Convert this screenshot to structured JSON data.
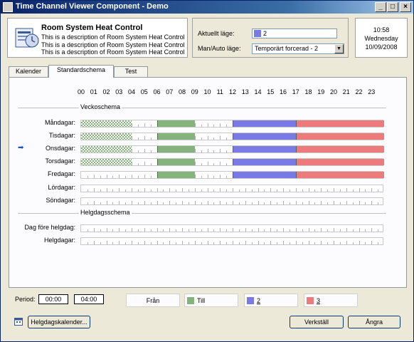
{
  "window": {
    "title": "Time Channel Viewer Component - Demo",
    "minimize": "_",
    "maximize": "□",
    "close": "×"
  },
  "header": {
    "title": "Room System Heat Control",
    "descriptions": [
      "This is a description of Room System Heat Control",
      "This is a description of Room System Heat Control",
      "This is a description of Room System Heat Control"
    ]
  },
  "mode": {
    "current_label": "Aktuellt läge:",
    "current_value": "2",
    "current_color": "#7a7ae6",
    "manual_label": "Man/Auto läge:",
    "manual_value": "Temporärt forcerad - 2"
  },
  "clock": {
    "time": "10:58",
    "day": "Wednesday",
    "date": "10/09/2008"
  },
  "tabs": [
    "Kalender",
    "Standardschema",
    "Test"
  ],
  "active_tab": "Standardschema",
  "hours": [
    "00",
    "01",
    "02",
    "03",
    "04",
    "05",
    "06",
    "07",
    "08",
    "09",
    "10",
    "11",
    "12",
    "13",
    "14",
    "15",
    "16",
    "17",
    "18",
    "19",
    "20",
    "21",
    "22",
    "23"
  ],
  "weekly": {
    "section_label": "Veckoschema",
    "days": [
      {
        "label": "Måndagar:",
        "segments": [
          [
            0,
            4,
            "check"
          ],
          [
            6,
            9,
            "t1"
          ],
          [
            12,
            17,
            "t2"
          ],
          [
            17,
            24,
            "t3"
          ]
        ]
      },
      {
        "label": "Tisdagar:",
        "segments": [
          [
            0,
            4,
            "check"
          ],
          [
            6,
            9,
            "t1"
          ],
          [
            12,
            17,
            "t2"
          ],
          [
            17,
            24,
            "t3"
          ]
        ]
      },
      {
        "label": "Onsdagar:",
        "current": true,
        "segments": [
          [
            0,
            4,
            "check"
          ],
          [
            6,
            9,
            "t1"
          ],
          [
            12,
            17,
            "t2"
          ],
          [
            17,
            24,
            "t3"
          ]
        ]
      },
      {
        "label": "Torsdagar:",
        "segments": [
          [
            0,
            4,
            "check"
          ],
          [
            6,
            9,
            "t1"
          ],
          [
            12,
            17,
            "t2"
          ],
          [
            17,
            24,
            "t3"
          ]
        ]
      },
      {
        "label": "Fredagar:",
        "segments": [
          [
            6,
            9,
            "t1"
          ],
          [
            12,
            17,
            "t2"
          ],
          [
            17,
            24,
            "t3"
          ]
        ]
      },
      {
        "label": "Lördagar:",
        "segments": []
      },
      {
        "label": "Söndagar:",
        "segments": []
      }
    ]
  },
  "holiday": {
    "section_label": "Helgdagsschema",
    "days": [
      {
        "label": "Dag före helgdag:",
        "segments": []
      },
      {
        "label": "Helgdagar:",
        "segments": []
      }
    ]
  },
  "period": {
    "label": "Period:",
    "from": "00:00",
    "to": "04:00"
  },
  "legend": [
    {
      "text": "Från",
      "color": ""
    },
    {
      "text": "Till",
      "color": "#84b47c"
    },
    {
      "text": "2",
      "color": "#7a7ae6"
    },
    {
      "text": "3",
      "color": "#ee7b7b"
    }
  ],
  "buttons": {
    "holiday_calendar": "Helgdagskalender...",
    "apply": "Verkställ",
    "cancel": "Ångra"
  }
}
